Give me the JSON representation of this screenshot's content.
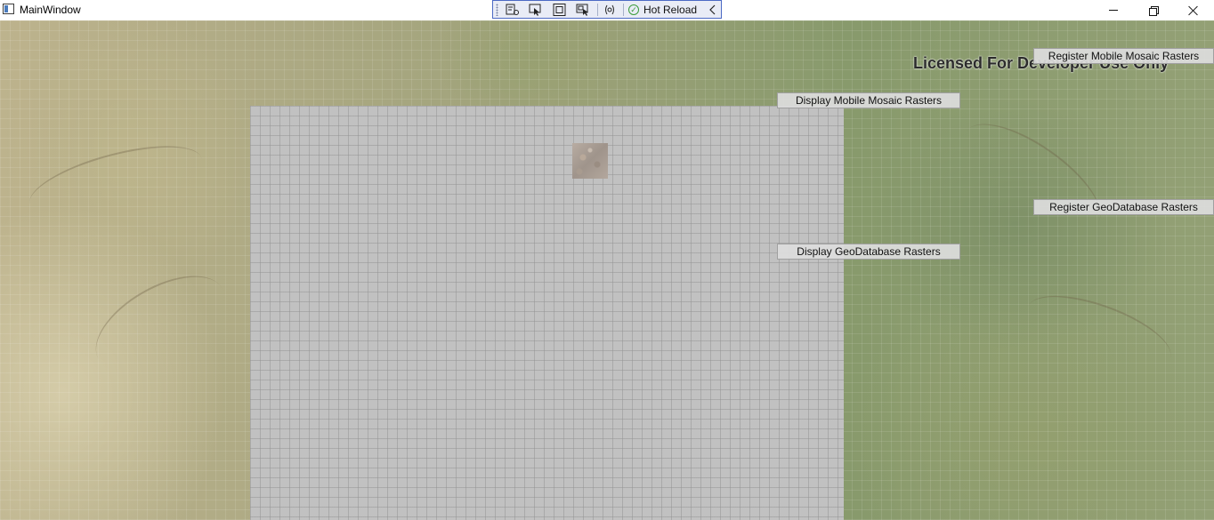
{
  "window": {
    "title": "MainWindow"
  },
  "debug_toolbar": {
    "hot_reload_label": "Hot Reload",
    "icons": [
      "select-element-icon",
      "pointer-icon",
      "display-layout-adorners-icon",
      "track-focused-element-icon",
      "binding-failures-icon",
      "hot-reload-status-icon",
      "collapse-chevron-icon"
    ]
  },
  "map": {
    "license_text": "Licensed For Developer Use Only"
  },
  "buttons": {
    "register_mobile_mosaic": "Register Mobile Mosaic Rasters",
    "display_mobile_mosaic": "Display Mobile Mosaic Rasters",
    "register_geodatabase": "Register GeoDatabase Rasters",
    "display_geodatabase": "Display GeoDatabase Rasters"
  },
  "colors": {
    "toolbar_border": "#4c6ac4",
    "toolbar_bg": "#e9ecf6",
    "hot_reload_ok": "#3a9c3a",
    "raster_extent": "#c1c1c1"
  }
}
